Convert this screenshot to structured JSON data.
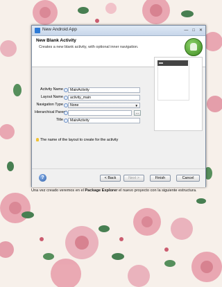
{
  "window": {
    "title": "New Android App"
  },
  "header": {
    "title": "New Blank Activity",
    "description": "Creates a new blank activity, with optional inner navigation."
  },
  "form": {
    "activity_name": {
      "label": "Activity Name",
      "value": "MainActivity"
    },
    "layout_name": {
      "label": "Layout Name",
      "value": "activity_main"
    },
    "navigation_type": {
      "label": "Navigation Type",
      "value": "None"
    },
    "hierarchical_parent": {
      "label": "Hierarchical Parent",
      "value": "",
      "browse_label": "..."
    },
    "title": {
      "label": "Title",
      "value": "MainActivity"
    }
  },
  "hint": {
    "text": "The name of the layout to create for the activity"
  },
  "footer": {
    "help_label": "?",
    "back_label": "< Back",
    "next_label": "Next >",
    "finish_label": "Finish",
    "cancel_label": "Cancel"
  },
  "caption": {
    "part1": "Una vez  creado veremos  en el ",
    "bold": "Package Explorer",
    "part2": " el nuevo  proyecto con la siguiente estructura."
  },
  "colors": {
    "accent": "#2d5fa8",
    "logo_green": "#3d8a20"
  }
}
